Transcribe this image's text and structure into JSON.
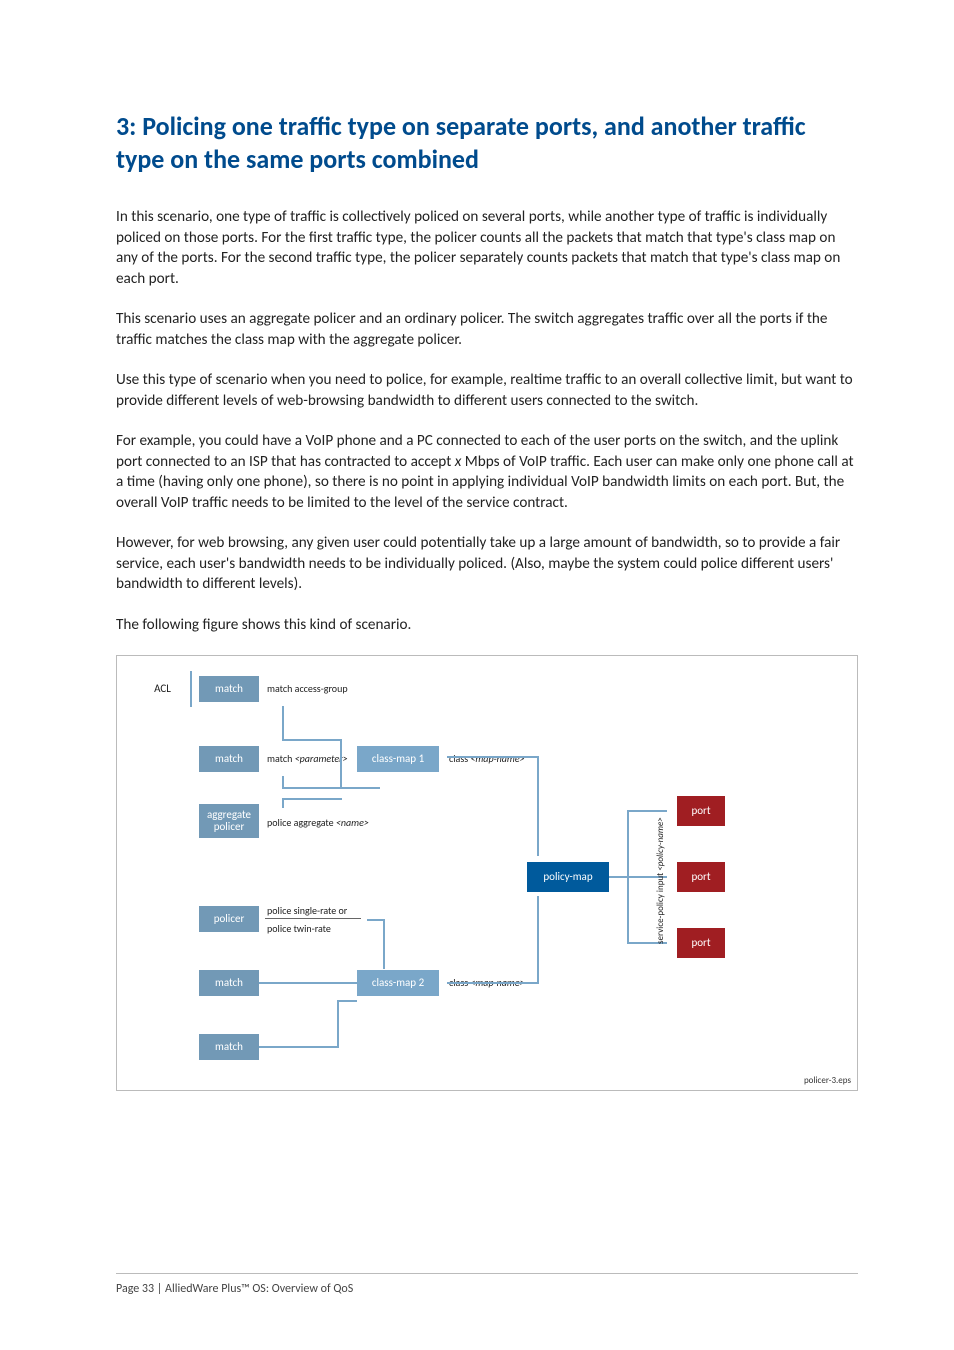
{
  "heading": "3: Policing one traffic type on separate ports, and another traffic type on the same ports combined",
  "paragraphs": {
    "p1": "In this scenario, one type of traffic is collectively policed on several ports, while another type of traffic is individually policed on those ports. For the first traffic type, the policer counts all the packets that match that type's class map on any of the ports. For the second traffic type, the policer separately counts packets that match that type's class map on each port.",
    "p2": "This scenario uses an aggregate policer and an ordinary policer. The switch aggregates traffic over all the ports if the traffic matches the class map with the aggregate policer.",
    "p3": "Use this type of scenario when you need to police, for example, realtime traffic to an overall collective limit, but want to provide different levels of web-browsing bandwidth to different users connected to the switch.",
    "p4a": "For example, you could have a VoIP phone and a PC connected to each of the user ports on the switch, and the uplink port connected to an ISP that has contracted to accept ",
    "p4b": "x",
    "p4c": " Mbps of VoIP traffic. Each user can make only one phone call at a time (having only one phone), so there is no point in applying individual VoIP bandwidth limits on each port. But, the overall VoIP traffic needs to be limited to the level of the service contract.",
    "p5": "However, for web browsing, any given user could potentially take up a large amount of bandwidth, so to provide a fair service, each user's bandwidth needs to be individually policed. (Also, maybe the system could police different users' bandwidth to different levels).",
    "p6": "The following figure shows this kind of scenario."
  },
  "diagram": {
    "acl": "ACL",
    "match": "match",
    "aggregate_policer": "aggregate policer",
    "policer": "policer",
    "classmap1": "class-map 1",
    "classmap2": "class-map 2",
    "policymap": "policy-map",
    "port": "port",
    "labels": {
      "match_access_group": "match access-group",
      "match_parameter_pre": "match ",
      "match_parameter_tag": "<parameter>",
      "police_aggregate_pre": "police aggregate ",
      "police_aggregate_tag": "<name>",
      "police_single": "police single-rate or",
      "police_twin": "police twin-rate",
      "class_pre": "class ",
      "class_tag": "<map-name>",
      "service_policy_pre": "service-policy input ",
      "service_policy_tag": "<policy-name>"
    },
    "filename": "policer-3.eps"
  },
  "footer": "Page 33 | AlliedWare Plus™ OS: Overview of QoS"
}
